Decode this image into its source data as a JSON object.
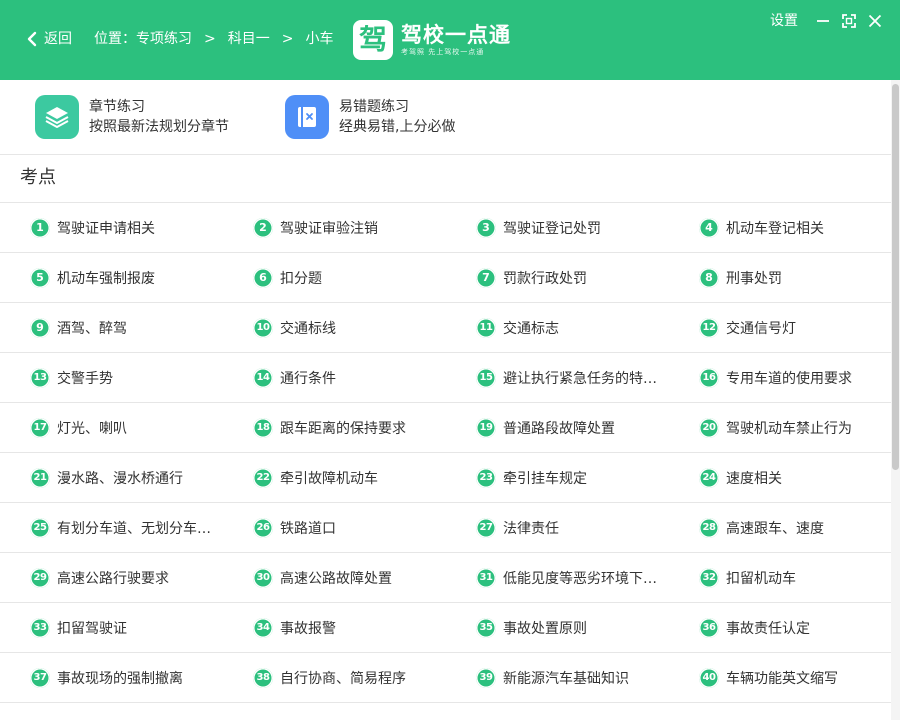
{
  "header": {
    "back_label": "返回",
    "breadcrumb": [
      "位置：专项练习",
      "科目一",
      "小车"
    ],
    "breadcrumb_sep": ">",
    "logo_mark": "驾",
    "logo_title": "驾校一点通",
    "logo_sub": "考驾照 先上驾校一点通",
    "settings_label": "设置",
    "brand_color": "#2cc07e"
  },
  "practice": [
    {
      "title": "章节练习",
      "subtitle": "按照最新法规划分章节",
      "icon": "layers-icon",
      "color": "#3cc9a0"
    },
    {
      "title": "易错题练习",
      "subtitle": "经典易错,上分必做",
      "icon": "book-x-icon",
      "color": "#4f8ff7"
    }
  ],
  "section_title": "考点",
  "topics": [
    {
      "n": "1",
      "label": "驾驶证申请相关"
    },
    {
      "n": "2",
      "label": "驾驶证审验注销"
    },
    {
      "n": "3",
      "label": "驾驶证登记处罚"
    },
    {
      "n": "4",
      "label": "机动车登记相关"
    },
    {
      "n": "5",
      "label": "机动车强制报废"
    },
    {
      "n": "6",
      "label": "扣分题"
    },
    {
      "n": "7",
      "label": "罚款行政处罚"
    },
    {
      "n": "8",
      "label": "刑事处罚"
    },
    {
      "n": "9",
      "label": "酒驾、醉驾"
    },
    {
      "n": "10",
      "label": "交通标线"
    },
    {
      "n": "11",
      "label": "交通标志"
    },
    {
      "n": "12",
      "label": "交通信号灯"
    },
    {
      "n": "13",
      "label": "交警手势"
    },
    {
      "n": "14",
      "label": "通行条件"
    },
    {
      "n": "15",
      "label": "避让执行紧急任务的特…"
    },
    {
      "n": "16",
      "label": "专用车道的使用要求"
    },
    {
      "n": "17",
      "label": "灯光、喇叭"
    },
    {
      "n": "18",
      "label": "跟车距离的保持要求"
    },
    {
      "n": "19",
      "label": "普通路段故障处置"
    },
    {
      "n": "20",
      "label": "驾驶机动车禁止行为"
    },
    {
      "n": "21",
      "label": "漫水路、漫水桥通行"
    },
    {
      "n": "22",
      "label": "牵引故障机动车"
    },
    {
      "n": "23",
      "label": "牵引挂车规定"
    },
    {
      "n": "24",
      "label": "速度相关"
    },
    {
      "n": "25",
      "label": "有划分车道、无划分车…"
    },
    {
      "n": "26",
      "label": "铁路道口"
    },
    {
      "n": "27",
      "label": "法律责任"
    },
    {
      "n": "28",
      "label": "高速跟车、速度"
    },
    {
      "n": "29",
      "label": "高速公路行驶要求"
    },
    {
      "n": "30",
      "label": "高速公路故障处置"
    },
    {
      "n": "31",
      "label": "低能见度等恶劣环境下…"
    },
    {
      "n": "32",
      "label": "扣留机动车"
    },
    {
      "n": "33",
      "label": "扣留驾驶证"
    },
    {
      "n": "34",
      "label": "事故报警"
    },
    {
      "n": "35",
      "label": "事故处置原则"
    },
    {
      "n": "36",
      "label": "事故责任认定"
    },
    {
      "n": "37",
      "label": "事故现场的强制撤离"
    },
    {
      "n": "38",
      "label": "自行协商、简易程序"
    },
    {
      "n": "39",
      "label": "新能源汽车基础知识"
    },
    {
      "n": "40",
      "label": "车辆功能英文缩写"
    }
  ]
}
